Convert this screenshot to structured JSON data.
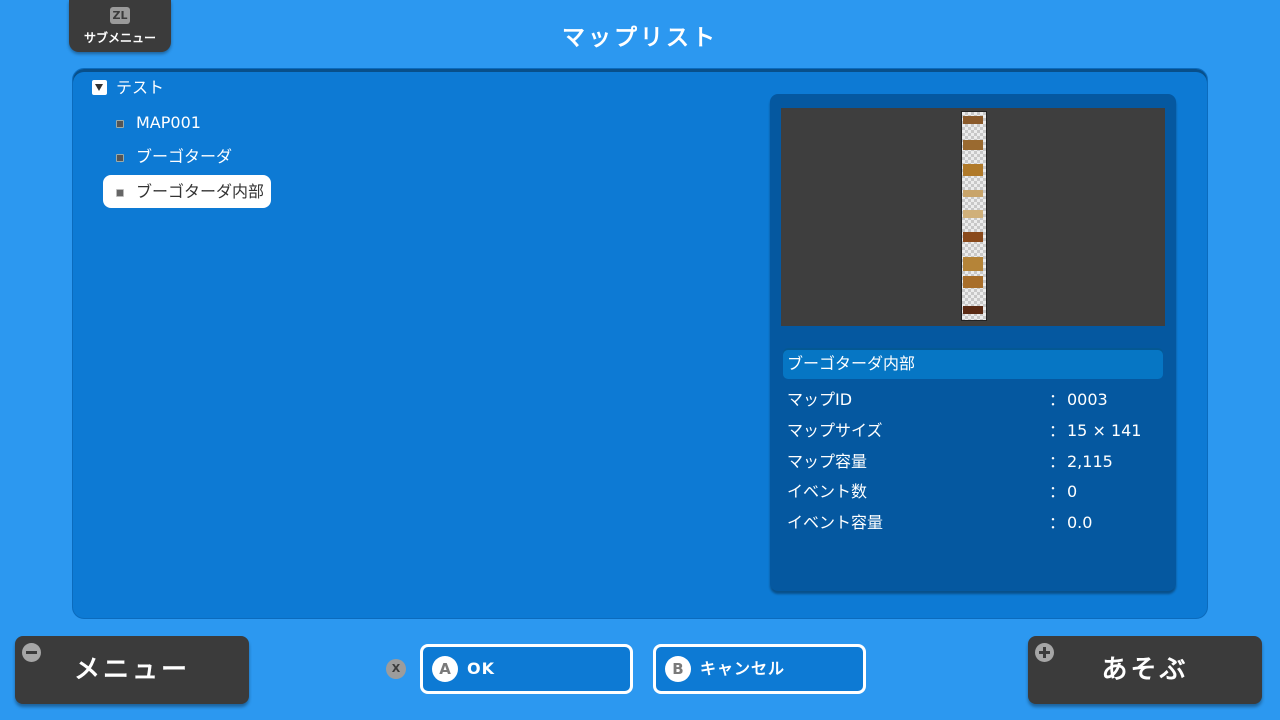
{
  "header": {
    "submenu_key": "ZL",
    "submenu_label": "サブメニュー",
    "title": "マップリスト"
  },
  "tree": {
    "folder": "テスト",
    "items": [
      {
        "label": "MAP001",
        "selected": false
      },
      {
        "label": "ブーゴターダ",
        "selected": false
      },
      {
        "label": "ブーゴターダ内部",
        "selected": true
      }
    ]
  },
  "info": {
    "map_name": "ブーゴターダ内部",
    "separator": "：",
    "rows": [
      {
        "key": "マップID",
        "value": "0003"
      },
      {
        "key": "マップサイズ",
        "value": "15 × 141"
      },
      {
        "key": "マップ容量",
        "value": "2,115"
      },
      {
        "key": "イベント数",
        "value": "0"
      },
      {
        "key": "イベント容量",
        "value": "0.0"
      }
    ]
  },
  "footer": {
    "menu_label": "メニュー",
    "x_key": "X",
    "ok_key": "A",
    "ok_label": "OK",
    "cancel_key": "B",
    "cancel_label": "キャンセル",
    "play_label": "あそぶ"
  },
  "colors": {
    "background": "#2c98f0",
    "panel": "#0d7ad4",
    "info_panel": "#0558a0",
    "button_dark": "#3b3b3b"
  }
}
